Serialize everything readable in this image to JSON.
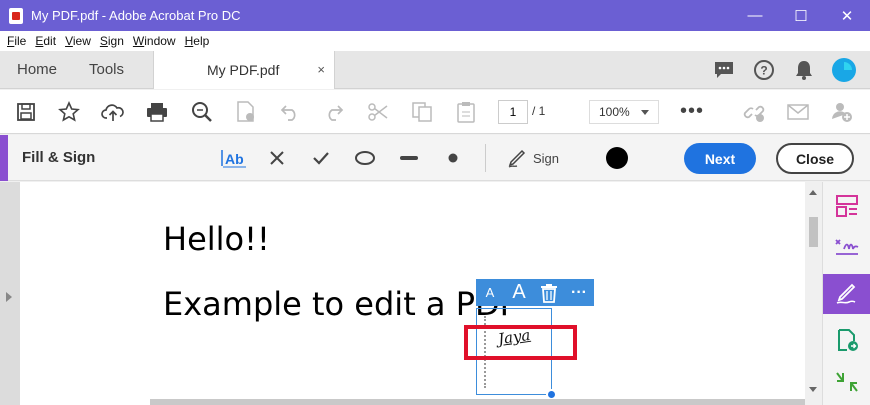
{
  "window": {
    "title": "My PDF.pdf - Adobe Acrobat Pro DC",
    "minimize": "—",
    "maximize": "☐",
    "close": "✕"
  },
  "menu": [
    "File",
    "Edit",
    "View",
    "Sign",
    "Window",
    "Help"
  ],
  "tabs": {
    "home": "Home",
    "tools": "Tools",
    "document": "My PDF.pdf",
    "close": "×"
  },
  "toolbar": {
    "page_current": "1",
    "page_total": "/  1",
    "zoom": "100%",
    "more": "•••"
  },
  "fill_sign": {
    "label": "Fill & Sign",
    "sign_label": "Sign",
    "next": "Next",
    "close": "Close",
    "color": "#000000"
  },
  "document": {
    "line1": "Hello!!",
    "line2": "Example to edit a PDF",
    "signature": "Jaya"
  },
  "float_toolbar": {
    "small_a": "A",
    "large_a": "A",
    "more": "···"
  },
  "colors": {
    "title_bar": "#6b5fd3",
    "accent": "#8a4fd0",
    "primary": "#1f73e0",
    "highlight": "#e0102a"
  }
}
